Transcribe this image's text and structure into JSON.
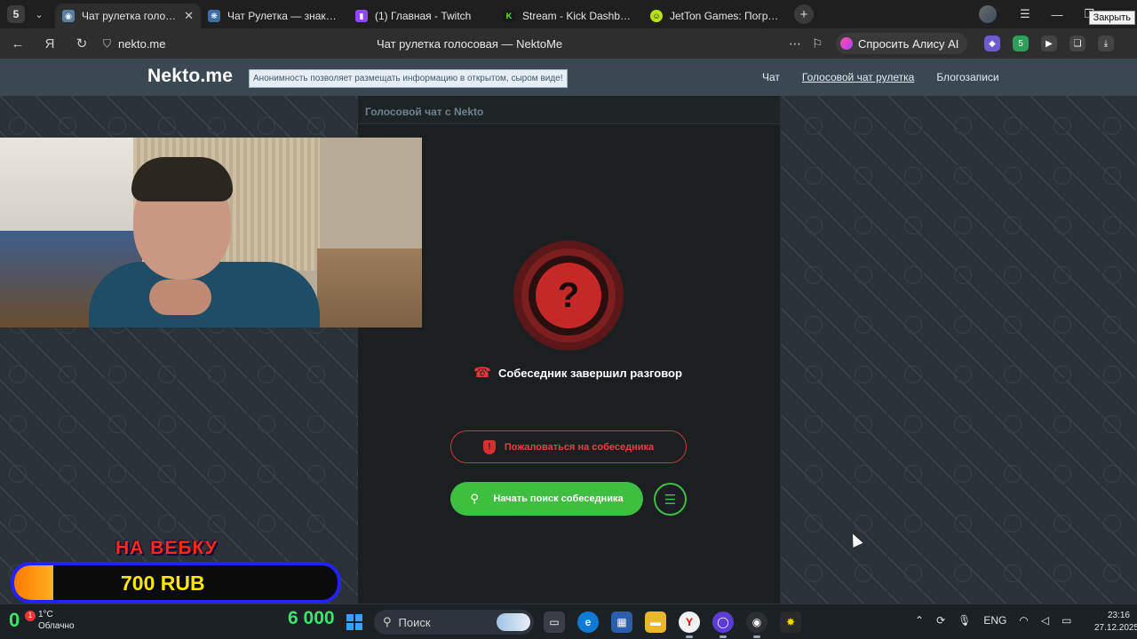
{
  "browser": {
    "tab_counter": "5",
    "tabs": [
      {
        "title": "Чат рулетка голосовая",
        "active": true
      },
      {
        "title": "Чат Рулетка — знакомства",
        "active": false
      },
      {
        "title": "(1) Главная - Twitch",
        "active": false
      },
      {
        "title": "Stream - Kick Dashboard",
        "active": false
      },
      {
        "title": "JetTon Games: Погружение",
        "active": false
      }
    ],
    "close_tooltip": "Закрыть",
    "url": "nekto.me",
    "page_title": "Чат рулетка голосовая — NektoMe",
    "alice_label": "Спросить Алису AI",
    "ext_badge": "5"
  },
  "site": {
    "logo": "Nekto.me",
    "tagline": "Анонимность позволяет размещать информацию в открытом, сыром виде!",
    "nav": [
      {
        "label": "Чат",
        "current": false
      },
      {
        "label": "Голосовой чат рулетка",
        "current": true
      },
      {
        "label": "Блогозаписи",
        "current": false
      }
    ]
  },
  "chat": {
    "header": "Голосовой чат с Nekto",
    "status_symbol": "?",
    "status_text": "Собеседник завершил разговор",
    "report_label": "Пожаловаться на собеседника",
    "start_label": "Начать поиск собеседника"
  },
  "overlay": {
    "donate_label": "НА ВЕБКУ",
    "donate_amount": "700 RUB",
    "donate_progress": 0.12
  },
  "taskbar": {
    "weather_temp": "1°C",
    "weather_desc": "Облачно",
    "weather_badge": "1",
    "weather_big": "0",
    "coins": "6 000",
    "search_placeholder": "Поиск",
    "lang": "ENG",
    "time": "23:16",
    "date": "27.12.2025"
  },
  "colors": {
    "accent_green": "#3fbf3f",
    "danger_red": "#c62828",
    "header_bg": "#3b4851",
    "donate_border": "#2222ff"
  }
}
